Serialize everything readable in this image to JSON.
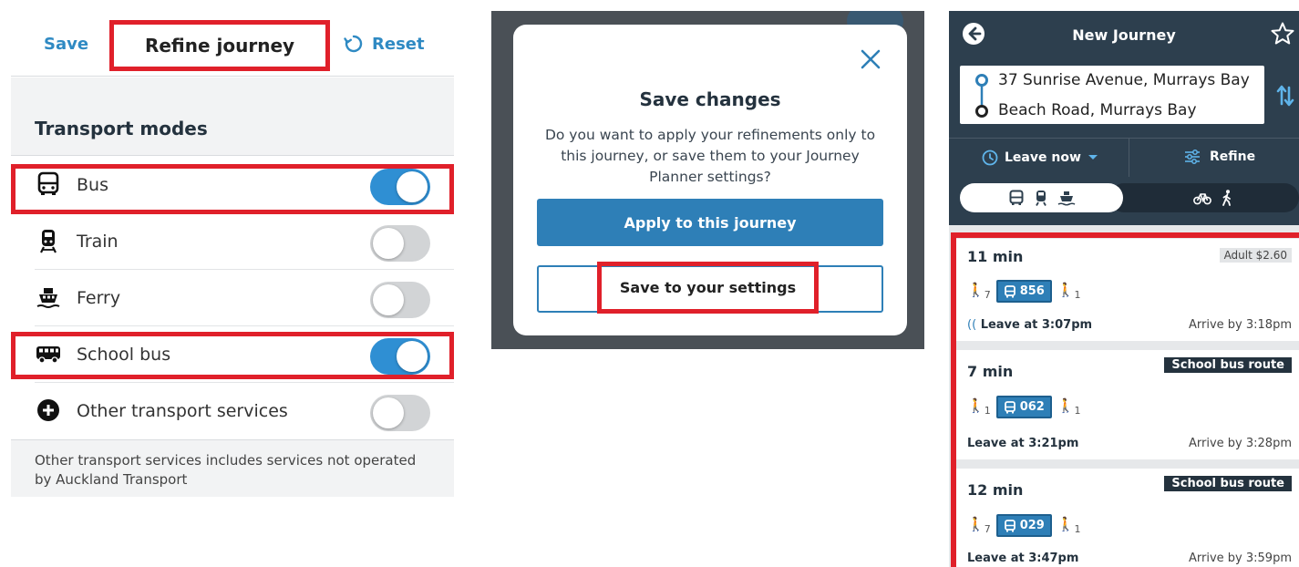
{
  "refine_panel": {
    "save_label": "Save",
    "title": "Refine journey",
    "reset_label": "Reset",
    "section_header": "Transport modes",
    "modes": [
      {
        "label": "Bus",
        "icon": "bus-icon",
        "enabled": true,
        "highlighted": true
      },
      {
        "label": "Train",
        "icon": "train-icon",
        "enabled": false,
        "highlighted": false
      },
      {
        "label": "Ferry",
        "icon": "ferry-icon",
        "enabled": false,
        "highlighted": false
      },
      {
        "label": "School bus",
        "icon": "school-bus-icon",
        "enabled": true,
        "highlighted": true
      },
      {
        "label": "Other transport services",
        "icon": "plus-circle-icon",
        "enabled": false,
        "highlighted": false
      }
    ],
    "footnote": "Other transport services includes services not operated by Auckland Transport"
  },
  "save_dialog": {
    "title": "Save changes",
    "body": "Do you want to apply your refinements only to this journey, or save them to your Journey Planner settings?",
    "apply_label": "Apply to this journey",
    "save_label": "Save to your settings"
  },
  "journey_panel": {
    "title": "New Journey",
    "from": "37 Sunrise Avenue, Murrays Bay",
    "to": "Beach Road, Murrays Bay",
    "leave_label": "Leave now",
    "refine_label": "Refine",
    "results": [
      {
        "duration": "11 min",
        "badge": "Adult $2.60",
        "badge_type": "fare",
        "walk_before": "7",
        "route": "856",
        "walk_after": "1",
        "leave": "Leave at 3:07pm",
        "arrive": "Arrive by 3:18pm",
        "realtime": true
      },
      {
        "duration": "7 min",
        "badge": "School bus route",
        "badge_type": "tag",
        "walk_before": "1",
        "route": "062",
        "walk_after": "1",
        "leave": "Leave at 3:21pm",
        "arrive": "Arrive by 3:28pm",
        "realtime": false
      },
      {
        "duration": "12 min",
        "badge": "School bus route",
        "badge_type": "tag",
        "walk_before": "7",
        "route": "029",
        "walk_after": "1",
        "leave": "Leave at 3:47pm",
        "arrive": "Arrive by 3:59pm",
        "realtime": false
      }
    ]
  },
  "colors": {
    "highlight": "#e0202a",
    "brand_blue": "#2e7fb7",
    "header_navy": "#2d3f4e",
    "walk_green": "#6a9a2c"
  }
}
